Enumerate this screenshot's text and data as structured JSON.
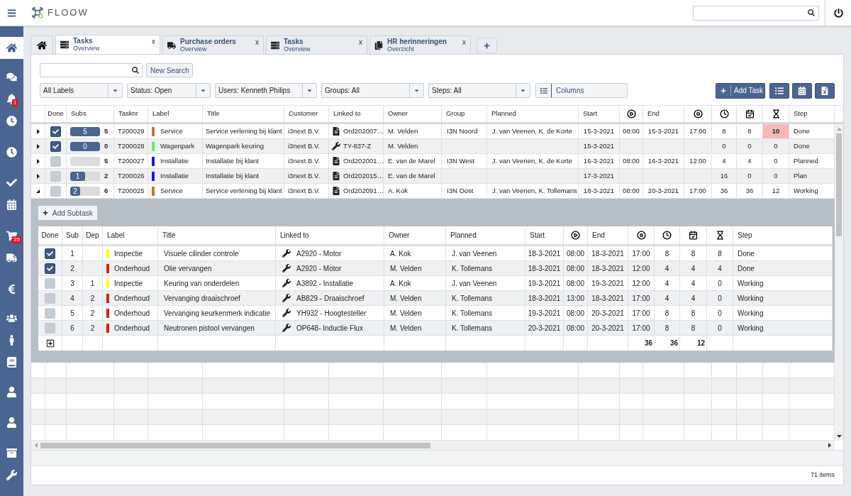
{
  "app": {
    "name": "FLOOW"
  },
  "sidebar": {
    "items": [
      {
        "selected": true
      },
      {
        "selected": false
      },
      {
        "selected": false,
        "badge": "1"
      },
      {
        "selected": false
      },
      {
        "selected": false
      },
      {
        "selected": false
      },
      {
        "selected": false
      },
      {
        "selected": false,
        "badge": "35"
      },
      {
        "selected": false
      },
      {
        "selected": false
      },
      {
        "selected": false
      },
      {
        "selected": false
      },
      {
        "selected": false
      },
      {
        "selected": false
      },
      {
        "selected": false
      },
      {
        "selected": false
      },
      {
        "selected": false
      }
    ]
  },
  "tabs": [
    {
      "kind": "home",
      "selected": false
    },
    {
      "title": "Tasks",
      "subtitle": "Overview",
      "close": "x",
      "selected": true
    },
    {
      "title": "Purchase orders",
      "subtitle": "Overview",
      "close": "x",
      "selected": false
    },
    {
      "title": "Tasks",
      "subtitle": "Overview",
      "close": "x",
      "selected": false
    },
    {
      "title": "HR herinneringen",
      "subtitle": "Overzicht",
      "close": "x",
      "selected": false
    }
  ],
  "toolbar": {
    "new_search": "New Search",
    "filters": [
      "All Labels",
      "Status: Open",
      "Users: Kenneth Philips",
      "Groups: All",
      "Steps: All"
    ],
    "columns": "Columns",
    "add_task": "Add Task"
  },
  "table": {
    "columns": [
      "Done",
      "Subs",
      "Tasknr",
      "Label",
      "Title",
      "Customer",
      "Linked to",
      "Owner",
      "Group",
      "Planned",
      "Start",
      "End",
      "Step"
    ],
    "rows": [
      {
        "expanded": false,
        "done": true,
        "subs": {
          "label": "5",
          "total": "5",
          "level": 1
        },
        "tasknr": "T200029",
        "label": "Service",
        "color": "#c87533",
        "title": "Service verlening bij klant",
        "customer": "i3next B.V.",
        "linked": {
          "kind": "document",
          "text": "Ord202007…"
        },
        "owner": "M. Velden",
        "group": "I3N Noord",
        "planned": "J. van Veenen, K. de Korte",
        "start": "15-3-2021",
        "start_time": "08:00",
        "end": "15-3-2021",
        "end_time": "17:00",
        "hours": [
          "8",
          "8",
          "10"
        ],
        "overdue": true,
        "step": "Done"
      },
      {
        "expanded": false,
        "done": true,
        "subs": {
          "label": "0",
          "total": "0",
          "level": 1
        },
        "tasknr": "T200028",
        "label": "Wagenpark",
        "color": "#66ee66",
        "title": "Wagenpark keuring",
        "customer": "i3next B.V.",
        "linked": {
          "kind": "tool",
          "text": "TY-837-Z"
        },
        "owner": "M. Velden",
        "start": "15-3-2021",
        "hours": [
          "0",
          "0",
          "0"
        ],
        "overdue": false,
        "step": "Done"
      },
      {
        "expanded": false,
        "done": false,
        "subs": {
          "total": "5",
          "level": 0
        },
        "tasknr": "T200027",
        "label": "Installatie",
        "color": "#1a1ad6",
        "title": "Installatie bij klant",
        "customer": "i3next B.V.",
        "linked": {
          "kind": "document",
          "text": "Ord202001…"
        },
        "owner": "E. van de Marel",
        "group": "I3N West",
        "planned": "J. van Veenen, K. de Korte",
        "start": "16-3-2021",
        "start_time": "08:00",
        "end": "16-3-2021",
        "end_time": "12:00",
        "hours": [
          "4",
          "4",
          "0"
        ],
        "overdue": false,
        "step": "Planned"
      },
      {
        "expanded": false,
        "done": false,
        "subs": {
          "label": "1",
          "total": "2",
          "level": 0.5
        },
        "tasknr": "T200026",
        "label": "Installatie",
        "color": "#1a1ad6",
        "title": "Installatie bij klant",
        "customer": "i3next B.V.",
        "linked": {
          "kind": "document",
          "text": "Ord202015…"
        },
        "owner": "E. van de Marel",
        "start": "17-3-2021",
        "hours": [
          "16",
          "0",
          "0"
        ],
        "overdue": false,
        "step": "Plan"
      },
      {
        "expanded": true,
        "done": false,
        "subs": {
          "label": "2",
          "total": "6",
          "level": 0.33
        },
        "tasknr": "T200025",
        "label": "Service",
        "color": "#c87533",
        "title": "Service verlening bij klant",
        "customer": "i3next B.V.",
        "linked": {
          "kind": "document",
          "text": "Ord202091…"
        },
        "owner": "A. Kok",
        "group": "I3N Oost",
        "planned": "J. van Veenen, K. Tollemans",
        "start": "18-3-2021",
        "start_time": "08:00",
        "end": "20-3-2021",
        "end_time": "17:00",
        "hours": [
          "36",
          "36",
          "12"
        ],
        "overdue": false,
        "step": "Working",
        "subtasks": {
          "add_label": "Add Subtask",
          "columns": [
            "Done",
            "Sub",
            "Dep",
            "Label",
            "Title",
            "Linked to",
            "Owner",
            "Planned",
            "Start",
            "End",
            "Step"
          ],
          "rows": [
            {
              "done": true,
              "sub": "1",
              "label": "Inspectie",
              "color": "#ffff00",
              "title": "Visuele cilinder controle",
              "linked": "A2920 - Motor",
              "owner": "A. Kok",
              "planned": "J. van Veenen",
              "start": "18-3-2021",
              "start_time": "08:00",
              "end": "18-3-2021",
              "end_time": "17:00",
              "hours": [
                "8",
                "8",
                "8"
              ],
              "step": "Done"
            },
            {
              "done": true,
              "sub": "2",
              "label": "Onderhoud",
              "color": "#dd2200",
              "title": "Olie vervangen",
              "linked": "A2920 - Motor",
              "owner": "M. Velden",
              "planned": "K. Tollemans",
              "start": "18-3-2021",
              "start_time": "08:00",
              "end": "18-3-2021",
              "end_time": "12:00",
              "hours": [
                "4",
                "4",
                "4"
              ],
              "step": "Done"
            },
            {
              "done": false,
              "sub": "3",
              "dep": "1",
              "label": "Inspectie",
              "color": "#ffff00",
              "title": "Keuring van onderdelen",
              "linked": "A3892 - Installatie",
              "owner": "A. Kok",
              "planned": "J. van Veenen",
              "start": "19-3-2021",
              "start_time": "08:00",
              "end": "19-3-2021",
              "end_time": "12:00",
              "hours": [
                "4",
                "4",
                "0"
              ],
              "step": "Working"
            },
            {
              "done": false,
              "sub": "4",
              "dep": "2",
              "label": "Onderhoud",
              "color": "#dd2200",
              "title": "Vervanging draaischroef",
              "linked": "AB829 - Draaischroef",
              "owner": "M. Velden",
              "planned": "K. Tollemans",
              "start": "18-3-2021",
              "start_time": "13:00",
              "end": "18-3-2021",
              "end_time": "17:00",
              "hours": [
                "4",
                "4",
                "0"
              ],
              "step": "Working"
            },
            {
              "done": false,
              "sub": "5",
              "dep": "2",
              "label": "Onderhoud",
              "color": "#dd2200",
              "title": "Vervanging keurkenmerk indicatie",
              "linked": "YH932 - Hoogtesteller",
              "owner": "M. Velden",
              "planned": "K. Tollemans",
              "start": "19-3-2021",
              "start_time": "08:00",
              "end": "20-3-2021",
              "end_time": "17:00",
              "hours": [
                "8",
                "8",
                "0"
              ],
              "step": "Working"
            },
            {
              "done": false,
              "sub": "6",
              "dep": "2",
              "label": "Onderhoud",
              "color": "#dd2200",
              "title": "Neutronen pistool vervangen",
              "linked": "OP648- Inductie Flux",
              "owner": "M. Velden",
              "planned": "K. Tollemans",
              "start": "20-3-2021",
              "start_time": "08:00",
              "end": "20-3-2021",
              "end_time": "17:00",
              "hours": [
                "8",
                "8",
                "0"
              ],
              "step": "Working"
            }
          ],
          "totals": [
            "36",
            "36",
            "12"
          ]
        }
      }
    ]
  },
  "footer": {
    "count": "71 items"
  }
}
